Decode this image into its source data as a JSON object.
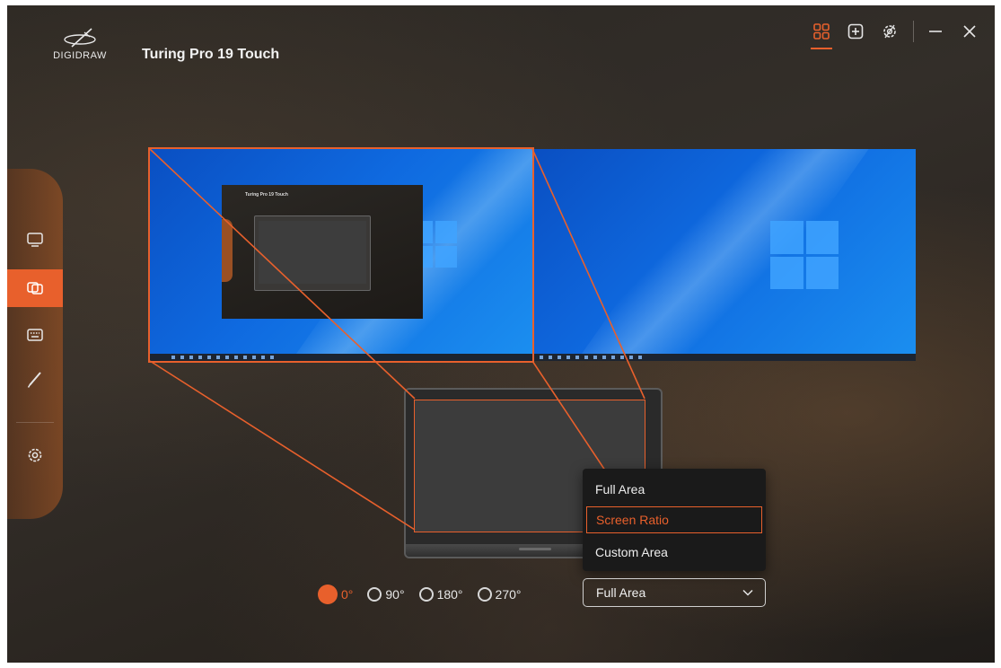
{
  "header": {
    "logo_text": "DIGIDRAW",
    "title": "Turing Pro 19 Touch"
  },
  "topbar": {
    "icons": [
      "dashboard-icon",
      "add-device-icon",
      "device-settings-icon",
      "minimize-icon",
      "close-icon"
    ],
    "active": "dashboard-icon"
  },
  "sidebar": {
    "items": [
      {
        "icon": "display-icon",
        "active": false
      },
      {
        "icon": "multi-display-icon",
        "active": true
      },
      {
        "icon": "shortcut-keys-icon",
        "active": false
      },
      {
        "icon": "pen-icon",
        "active": false
      },
      {
        "icon": "settings-gear-icon",
        "active": false
      }
    ]
  },
  "mini_app": {
    "title": "Turing Pro 19 Touch"
  },
  "rotation": {
    "options": [
      "0°",
      "90°",
      "180°",
      "270°"
    ],
    "selected": "0°"
  },
  "area_select": {
    "value": "Full Area",
    "options": [
      "Full Area",
      "Screen Ratio",
      "Custom Area"
    ],
    "highlighted": "Screen Ratio"
  },
  "colors": {
    "accent": "#e8602c",
    "windows_blue": "#0f6ae0",
    "text": "#f2f2f2"
  }
}
